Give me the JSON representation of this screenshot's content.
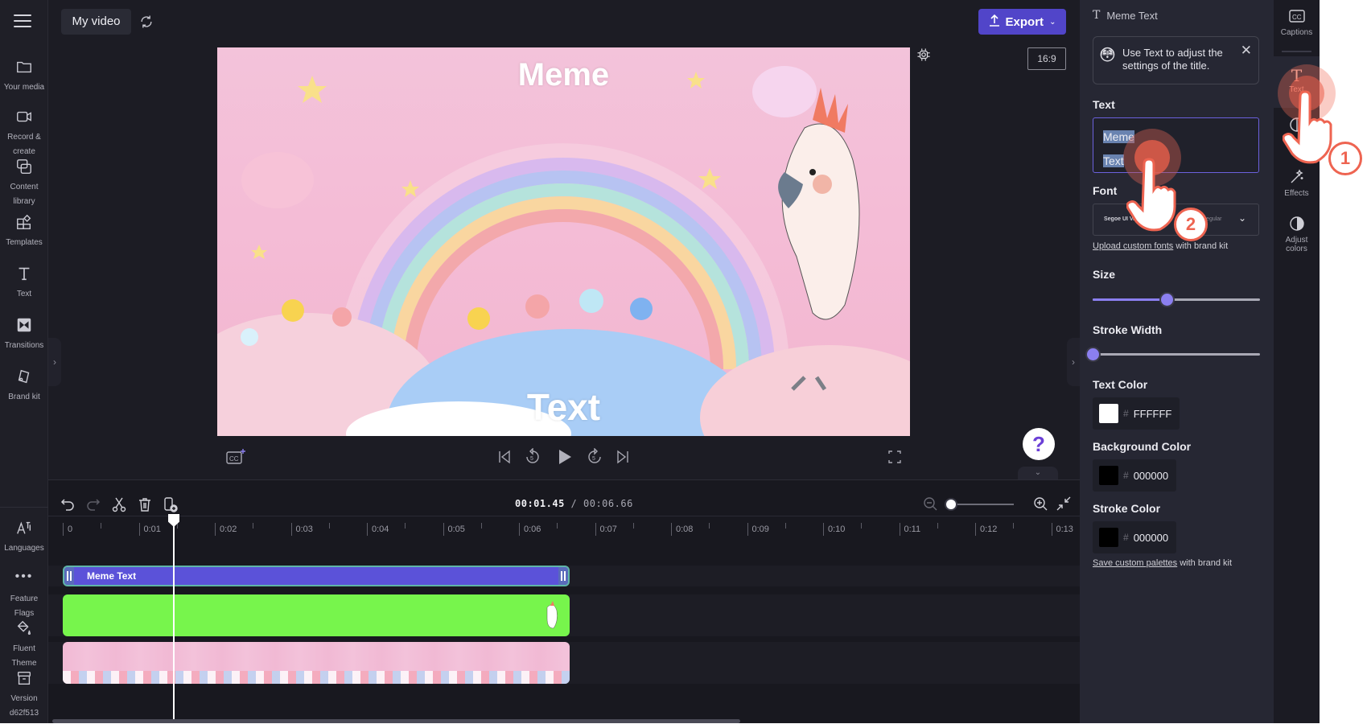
{
  "app": {
    "project_title": "My video",
    "export_label": "Export",
    "aspect_ratio": "16:9"
  },
  "left_nav": {
    "items": [
      {
        "label": "Your media",
        "icon": "folder-icon"
      },
      {
        "label": "Record & create",
        "icon": "video-camera-icon"
      },
      {
        "label": "Content library",
        "icon": "content-library-icon"
      },
      {
        "label": "Templates",
        "icon": "templates-icon"
      },
      {
        "label": "Text",
        "icon": "text-icon"
      },
      {
        "label": "Transitions",
        "icon": "transitions-icon"
      },
      {
        "label": "Brand kit",
        "icon": "brand-kit-icon"
      }
    ],
    "bottom_items": [
      {
        "label": "Languages",
        "icon": "languages-icon"
      },
      {
        "label": "Feature Flags",
        "icon": "more-dots-icon"
      },
      {
        "label": "Fluent Theme",
        "icon": "paint-bucket-icon"
      },
      {
        "label": "Version d62f513",
        "icon": "archive-icon"
      }
    ]
  },
  "preview": {
    "top_text": "Meme",
    "bottom_text": "Text"
  },
  "timeline": {
    "current_time": "00:01.45",
    "total_time": "00:06.66",
    "separator": "/",
    "ruler_labels": [
      "0",
      "0:01",
      "0:02",
      "0:03",
      "0:04",
      "0:05",
      "0:06",
      "0:07",
      "0:08",
      "0:09",
      "0:10",
      "0:11",
      "0:12",
      "0:13"
    ],
    "zoom_level": 0,
    "playhead_seconds": 1.45,
    "clips": [
      {
        "type": "text",
        "label": "Meme Text",
        "color": "#5b52d9"
      },
      {
        "type": "overlay",
        "label": "cockatoo on green screen",
        "color": "#77f54c"
      },
      {
        "type": "background",
        "label": "pastel rainbow background",
        "color": "#f1b9d4"
      }
    ]
  },
  "properties": {
    "header": "Meme Text",
    "tip_text": "Use Text to adjust the settings of the title.",
    "text_label": "Text",
    "text_lines": [
      "Meme",
      "Text"
    ],
    "font_label": "Font",
    "font_name": "Segoe UI Variable",
    "font_weight": "Regular",
    "upload_fonts_link": "Upload custom fonts",
    "upload_fonts_suffix": " with brand kit",
    "size_label": "Size",
    "size_value": 0.44,
    "stroke_width_label": "Stroke Width",
    "stroke_width_value": 0,
    "text_color_label": "Text Color",
    "text_color": "FFFFFF",
    "bg_color_label": "Background Color",
    "bg_color": "000000",
    "stroke_color_label": "Stroke Color",
    "stroke_color": "000000",
    "hash": "#",
    "save_palettes_link": "Save custom palettes",
    "save_palettes_suffix": " with brand kit"
  },
  "right_strip": {
    "items": [
      {
        "label": "Captions",
        "icon": "captions-icon"
      },
      {
        "label": "Text",
        "icon": "text-icon",
        "active": true
      },
      {
        "label": "Effects",
        "icon": "magic-wand-icon"
      },
      {
        "label": "Adjust colors",
        "icon": "contrast-icon"
      }
    ]
  },
  "tutorial": {
    "step1": "1",
    "step2": "2"
  },
  "colors": {
    "accent": "#5145c9",
    "slider": "#8b7ff0",
    "text_clip": "#5b52d9",
    "green_clip": "#77f54c",
    "pointer": "#ee6451"
  }
}
